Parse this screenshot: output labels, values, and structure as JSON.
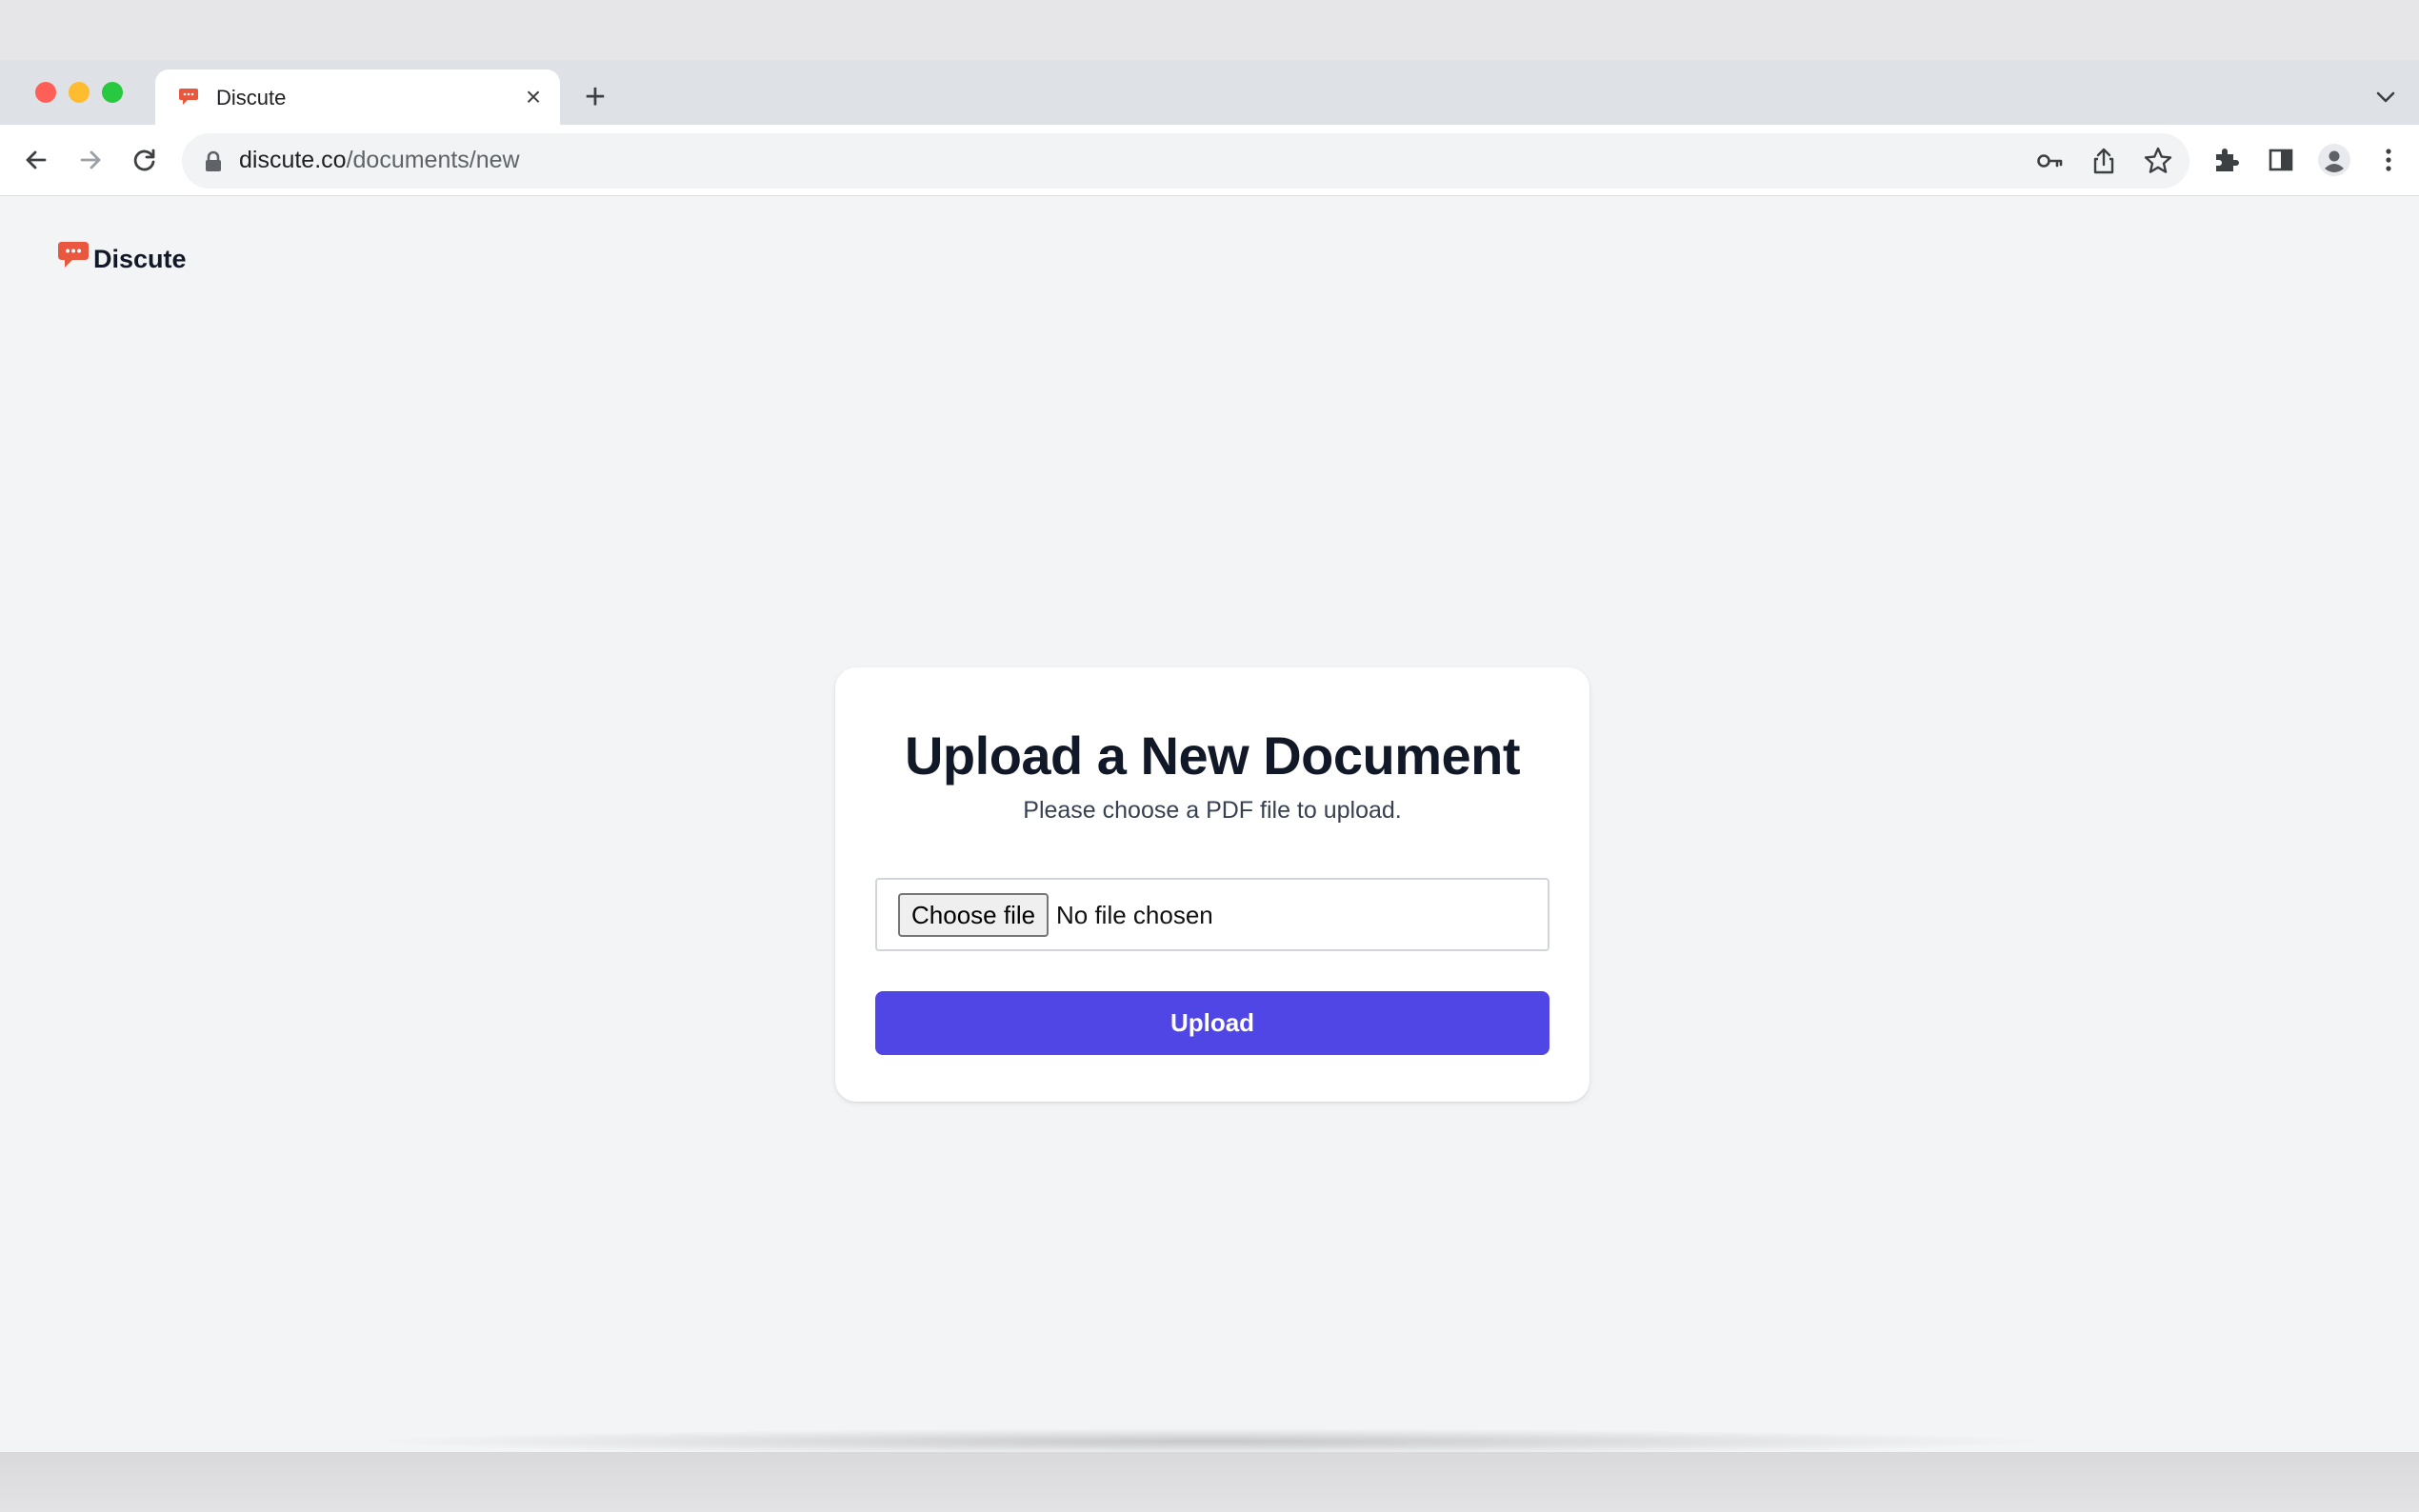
{
  "browser": {
    "tab_title": "Discute",
    "tab_close": "×",
    "new_tab": "+",
    "url_domain": "discute.co",
    "url_path": "/documents/new"
  },
  "icons": {
    "back": "arrow-left-icon",
    "forward": "arrow-right-icon",
    "reload": "reload-icon",
    "lock": "lock-icon",
    "password": "key-icon",
    "share": "share-icon",
    "bookmark": "star-icon",
    "extensions": "puzzle-icon",
    "side_panel": "side-panel-icon",
    "profile": "profile-avatar-icon",
    "menu": "kebab-menu-icon",
    "tab_list": "chevron-down-icon",
    "brand": "chat-bubble-icon"
  },
  "colors": {
    "accent": "#4f46e5",
    "brand": "#e9573f",
    "page_bg": "#f3f4f6"
  },
  "header": {
    "brand_name": "Discute"
  },
  "upload_form": {
    "title": "Upload a New Document",
    "subtitle": "Please choose a PDF file to upload.",
    "choose_file_label": "Choose file",
    "file_status": "No file chosen",
    "submit_label": "Upload"
  }
}
